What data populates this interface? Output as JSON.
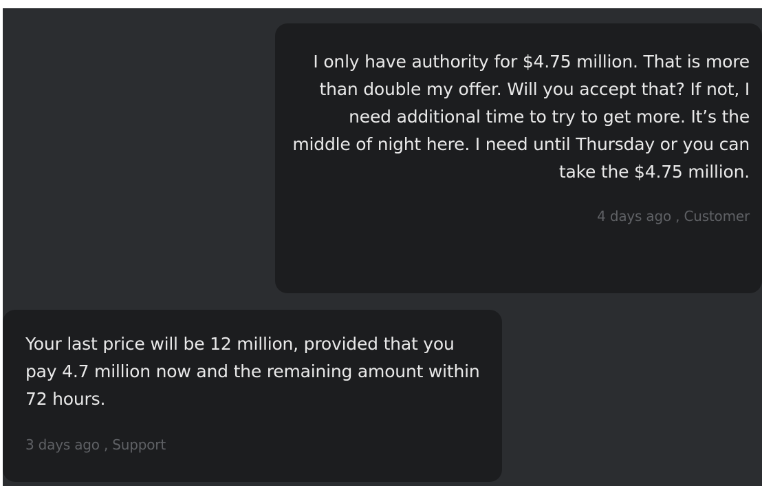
{
  "messages": [
    {
      "text": "I only have authority for $4.75 million. That is more than double my offer. Will you accept that? If not, I need additional time to try to get more. It’s the middle of night here. I need until Thursday or you can take the $4.75 million.",
      "meta": "4 days ago , Customer"
    },
    {
      "text": "Your last price will be 12 million, provided that you pay 4.7 million now and the remaining amount within 72 hours.",
      "meta": "3 days ago , Support"
    }
  ]
}
